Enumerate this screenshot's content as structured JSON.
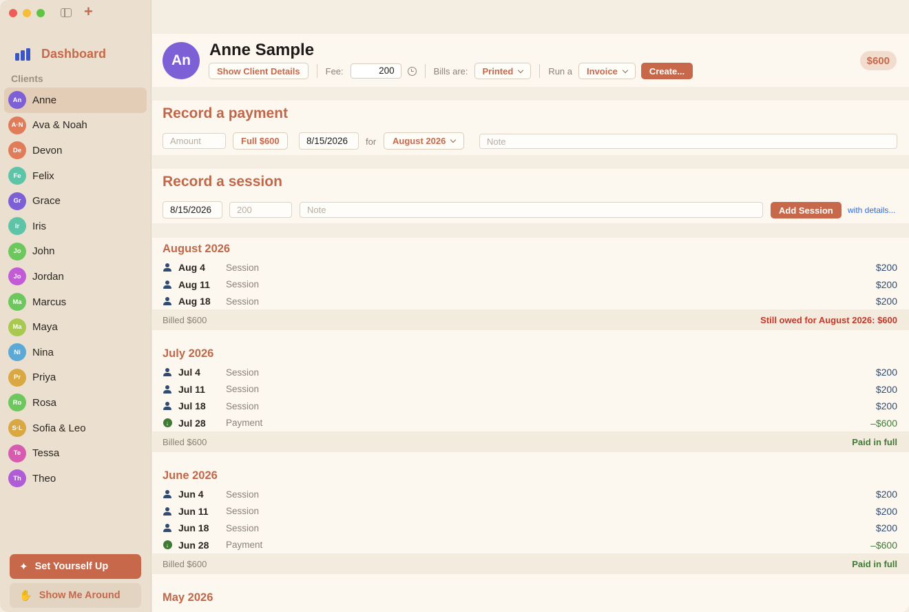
{
  "sidebar": {
    "dashboard_label": "Dashboard",
    "clients_heading": "Clients",
    "clients": [
      {
        "initials": "An",
        "name": "Anne",
        "color": "#7d5fd6",
        "active": true
      },
      {
        "initials": "A·N",
        "name": "Ava & Noah",
        "color": "#e07c5a"
      },
      {
        "initials": "De",
        "name": "Devon",
        "color": "#e07c5a"
      },
      {
        "initials": "Fe",
        "name": "Felix",
        "color": "#5ec4a8"
      },
      {
        "initials": "Gr",
        "name": "Grace",
        "color": "#7d5fd6"
      },
      {
        "initials": "Ir",
        "name": "Iris",
        "color": "#5ec4a8"
      },
      {
        "initials": "Jo",
        "name": "John",
        "color": "#6cc85c"
      },
      {
        "initials": "Jo",
        "name": "Jordan",
        "color": "#c25cd6"
      },
      {
        "initials": "Ma",
        "name": "Marcus",
        "color": "#6cc85c"
      },
      {
        "initials": "Ma",
        "name": "Maya",
        "color": "#a8c84e"
      },
      {
        "initials": "Ni",
        "name": "Nina",
        "color": "#5ca8d6"
      },
      {
        "initials": "Pr",
        "name": "Priya",
        "color": "#d9a843"
      },
      {
        "initials": "Ro",
        "name": "Rosa",
        "color": "#6cc85c"
      },
      {
        "initials": "S·L",
        "name": "Sofia & Leo",
        "color": "#d9a843"
      },
      {
        "initials": "Te",
        "name": "Tessa",
        "color": "#d65cb0"
      },
      {
        "initials": "Th",
        "name": "Theo",
        "color": "#b05cd6"
      }
    ],
    "setup_label": "Set Yourself Up",
    "tour_label": "Show Me Around"
  },
  "header": {
    "initials": "An",
    "client_name": "Anne Sample",
    "show_details_label": "Show Client Details",
    "fee_label": "Fee:",
    "fee_value": "200",
    "bills_label": "Bills are:",
    "bills_value": "Printed",
    "run_label": "Run a",
    "run_value": "Invoice",
    "create_label": "Create...",
    "balance": "$600"
  },
  "payment": {
    "title": "Record a payment",
    "amount_placeholder": "Amount",
    "full_label": "Full $600",
    "date": "8/15/2026",
    "for_label": "for",
    "month_value": "August 2026",
    "note_placeholder": "Note"
  },
  "session": {
    "title": "Record a session",
    "date": "8/15/2026",
    "fee_placeholder": "200",
    "note_placeholder": "Note",
    "add_label": "Add Session",
    "details_link": "with details..."
  },
  "months": [
    {
      "title": "August 2026",
      "entries": [
        {
          "type": "session",
          "date": "Aug 4",
          "kind": "Session",
          "amount": "$200"
        },
        {
          "type": "session",
          "date": "Aug 11",
          "kind": "Session",
          "amount": "$200"
        },
        {
          "type": "session",
          "date": "Aug 18",
          "kind": "Session",
          "amount": "$200"
        }
      ],
      "billed": "Billed $600",
      "status": "Still owed for August 2026: $600",
      "status_type": "owed"
    },
    {
      "title": "July 2026",
      "entries": [
        {
          "type": "session",
          "date": "Jul 4",
          "kind": "Session",
          "amount": "$200"
        },
        {
          "type": "session",
          "date": "Jul 11",
          "kind": "Session",
          "amount": "$200"
        },
        {
          "type": "session",
          "date": "Jul 18",
          "kind": "Session",
          "amount": "$200"
        },
        {
          "type": "payment",
          "date": "Jul 28",
          "kind": "Payment",
          "amount": "–$600"
        }
      ],
      "billed": "Billed $600",
      "status": "Paid in full",
      "status_type": "paid"
    },
    {
      "title": "June 2026",
      "entries": [
        {
          "type": "session",
          "date": "Jun 4",
          "kind": "Session",
          "amount": "$200"
        },
        {
          "type": "session",
          "date": "Jun 11",
          "kind": "Session",
          "amount": "$200"
        },
        {
          "type": "session",
          "date": "Jun 18",
          "kind": "Session",
          "amount": "$200"
        },
        {
          "type": "payment",
          "date": "Jun 28",
          "kind": "Payment",
          "amount": "–$600"
        }
      ],
      "billed": "Billed $600",
      "status": "Paid in full",
      "status_type": "paid"
    },
    {
      "title": "May 2026",
      "entries": [],
      "billed": "",
      "status": "",
      "status_type": ""
    }
  ]
}
